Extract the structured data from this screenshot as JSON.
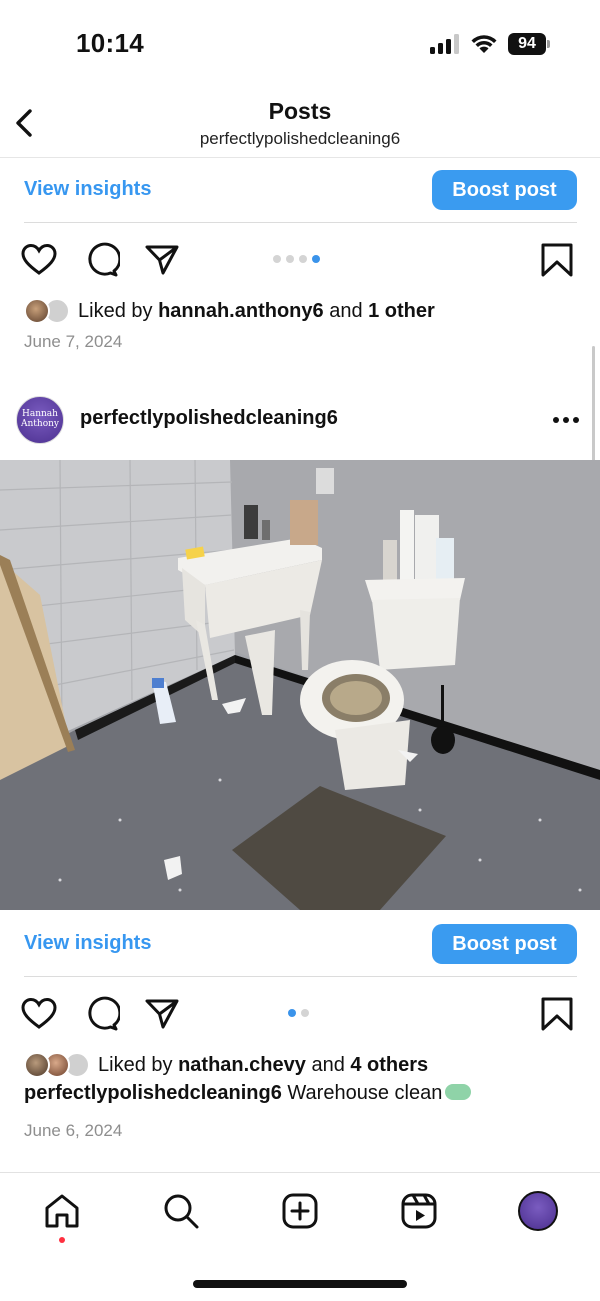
{
  "status_bar": {
    "time": "10:14",
    "battery": "94"
  },
  "header": {
    "title": "Posts",
    "subtitle": "perfectlypolishedcleaning6"
  },
  "post_prev": {
    "view_insights": "View insights",
    "boost_post": "Boost post",
    "carousel": {
      "count": 4,
      "active_index": 3
    },
    "liked_prefix": "Liked by ",
    "liked_user": "hannah.anthony6",
    "liked_and": " and ",
    "liked_others": "1 other",
    "date": "June 7, 2024"
  },
  "post": {
    "username": "perfectlypolishedcleaning6",
    "avatar_text": "Hannah Anthony",
    "view_insights": "View insights",
    "boost_post": "Boost post",
    "carousel": {
      "count": 2,
      "active_index": 0
    },
    "liked_prefix": "Liked by ",
    "liked_user": "nathan.chevy",
    "liked_and": " and ",
    "liked_others": "4 others",
    "caption_user": "perfectlypolishedcleaning6",
    "caption_text": " Warehouse clean",
    "date": "June 6, 2024"
  },
  "nav": [
    "home-icon",
    "search-icon",
    "create-icon",
    "reels-icon",
    "profile-avatar"
  ],
  "colors": {
    "accent": "#3797f0",
    "boost_bg": "#3a9bf0",
    "notification_dot": "#ff3040"
  }
}
